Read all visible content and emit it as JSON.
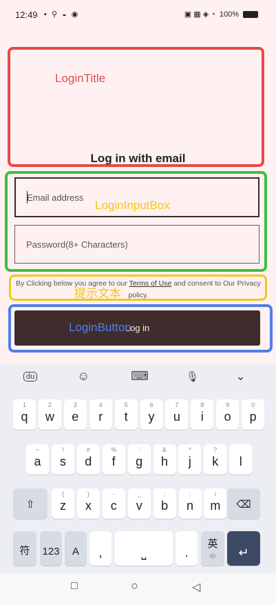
{
  "status": {
    "time": "12:49",
    "left_icons": "▪ ⚲ ◒ ◉",
    "right_icons": "▣ ▦ ◈ ◔",
    "battery": "100%"
  },
  "annotations": {
    "title_label": "LoginTitle",
    "input_label": "LoginInputBox",
    "hint_label": "提示文本",
    "button_label": "LoginButton"
  },
  "heading": "Log in with email",
  "email": {
    "placeholder": "Email address"
  },
  "password": {
    "placeholder": "Password(8+ Characters)"
  },
  "hint": {
    "pre": "By Clicking below you agree to our ",
    "terms": "Terms of Use",
    "mid": " and consent to Our Privacy policy."
  },
  "login_button": "Log in",
  "keyboard": {
    "toolbar": [
      "du",
      "☺",
      "⌨",
      "🎙",
      "⌄"
    ],
    "row1": [
      [
        "1",
        "q"
      ],
      [
        "2",
        "w"
      ],
      [
        "3",
        "e"
      ],
      [
        "4",
        "r"
      ],
      [
        "5",
        "t"
      ],
      [
        "6",
        "y"
      ],
      [
        "7",
        "u"
      ],
      [
        "8",
        "i"
      ],
      [
        "9",
        "o"
      ],
      [
        "0",
        "p"
      ]
    ],
    "row2": [
      [
        "~",
        "a"
      ],
      [
        "!",
        "s"
      ],
      [
        "#",
        "d"
      ],
      [
        "%",
        "f"
      ],
      [
        "'",
        "g"
      ],
      [
        "&",
        "h"
      ],
      [
        "*",
        "j"
      ],
      [
        "?",
        "k"
      ],
      [
        "",
        "l"
      ]
    ],
    "row3": [
      [
        "(",
        "z"
      ],
      [
        ")",
        "x"
      ],
      [
        "-",
        "c"
      ],
      [
        "_",
        "v"
      ],
      [
        ":",
        "b"
      ],
      [
        ";",
        "n"
      ],
      [
        "/",
        "m"
      ]
    ],
    "shift": "⇧",
    "backspace": "⌫",
    "symbols": "符",
    "numbers": "123",
    "letters": "A",
    "comma": ",",
    "space": "⎵",
    "period": ".",
    "lang": "英",
    "lang_sub": "中",
    "enter": "↵"
  },
  "nav": {
    "recent": "□",
    "home": "○",
    "back": "◁"
  }
}
